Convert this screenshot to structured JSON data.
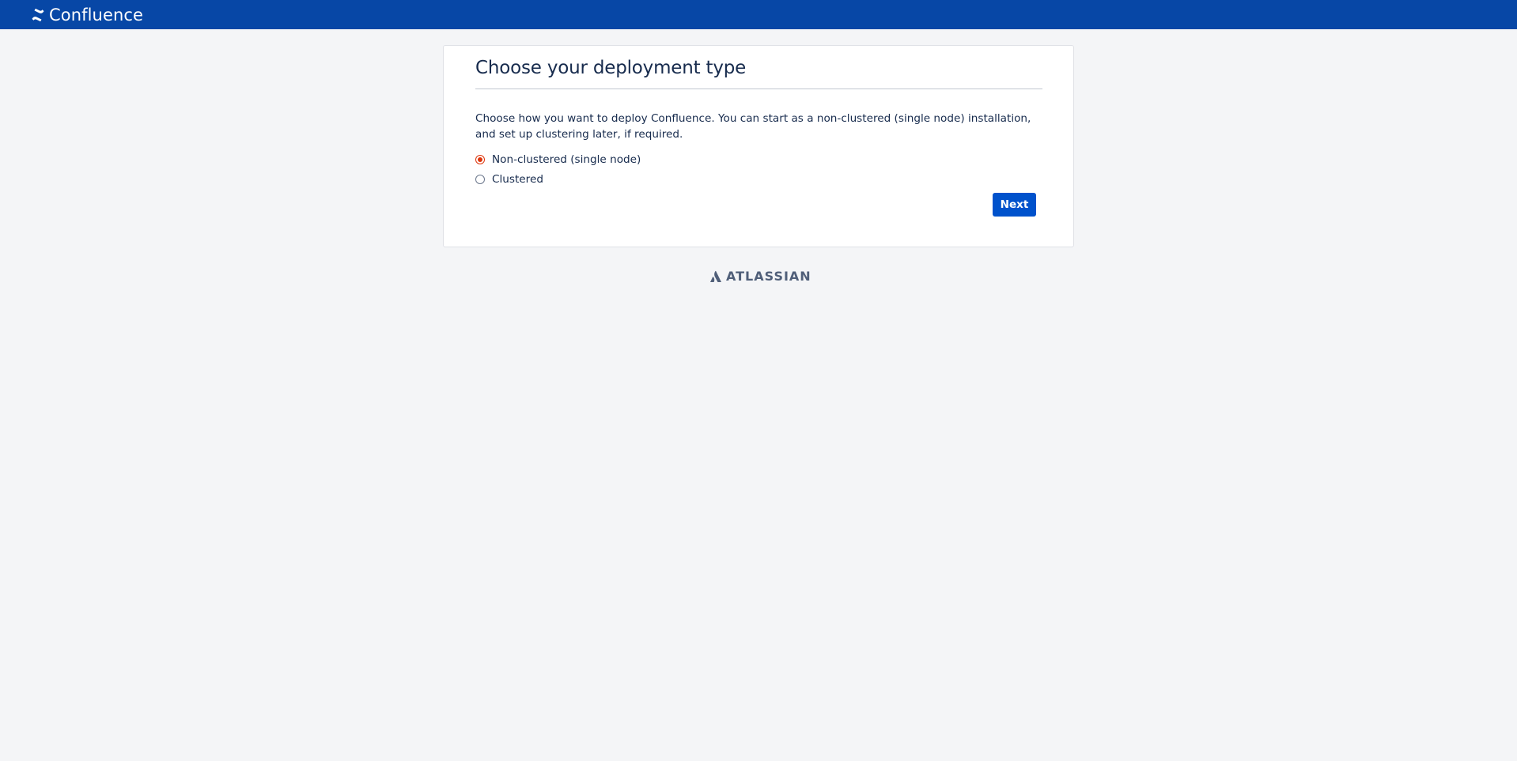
{
  "header": {
    "product_name": "Confluence",
    "brand_color": "#0747a6",
    "logo_icon": "confluence-logo-icon"
  },
  "setup": {
    "title": "Choose your deployment type",
    "description": "Choose how you want to deploy Confluence. You can start as a non-clustered (single node) installation, and set up clustering later, if required.",
    "options": [
      {
        "label": "Non-clustered (single node)",
        "selected": true
      },
      {
        "label": "Clustered",
        "selected": false
      }
    ],
    "next_label": "Next",
    "accent_color": "#0052cc",
    "selected_radio_color": "#de350b"
  },
  "footer": {
    "vendor": "ATLASSIAN",
    "logo_icon": "atlassian-logo-icon"
  }
}
